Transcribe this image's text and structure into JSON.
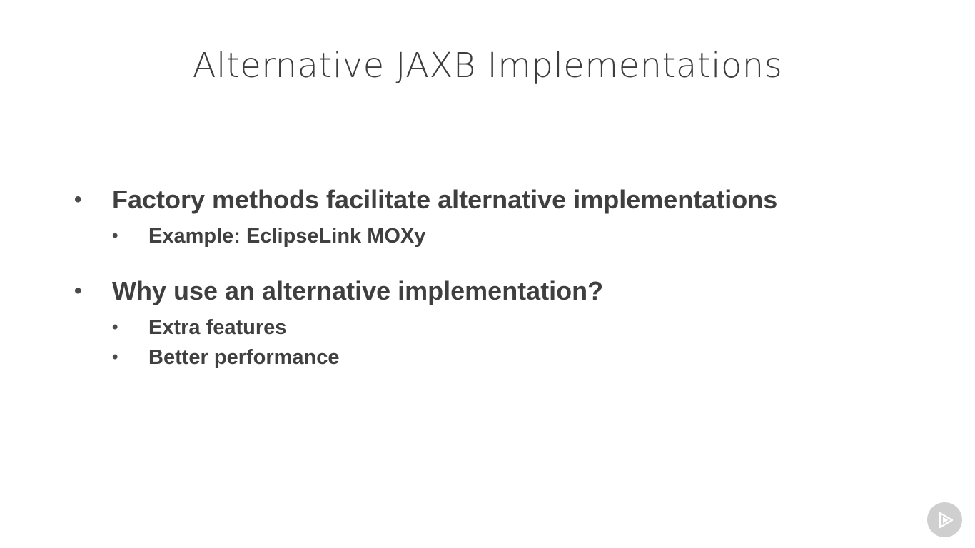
{
  "slide": {
    "title": "Alternative JAXB Implementations",
    "bullets": [
      {
        "text": "Factory methods facilitate alternative implementations",
        "sub": [
          "Example: EclipseLink MOXy"
        ]
      },
      {
        "text": "Why use an alternative implementation?",
        "sub": [
          "Extra features",
          "Better performance"
        ]
      }
    ],
    "bullet_glyph": "•"
  },
  "badge": {
    "icon": "play-logo-icon",
    "color": "#cfcfcf"
  }
}
